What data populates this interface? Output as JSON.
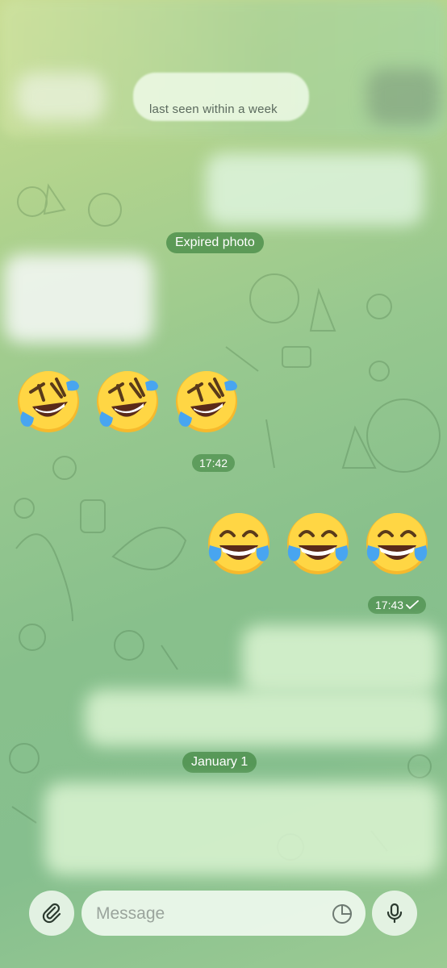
{
  "header": {
    "status": "last seen within a week"
  },
  "chat": {
    "expired_photo_label": "Expired photo",
    "incoming_emoji": [
      "🤣",
      "🤣",
      "🤣"
    ],
    "incoming_time": "17:42",
    "outgoing_emoji": [
      "😂",
      "😂",
      "😂"
    ],
    "outgoing_time": "17:43",
    "outgoing_status_icon": "single-check-icon",
    "date_separator": "January 1"
  },
  "input": {
    "placeholder": "Message",
    "attach_icon": "paperclip-icon",
    "sticker_icon": "sticker-icon",
    "mic_icon": "microphone-icon"
  },
  "colors": {
    "chip_bg": "#4f9a4f",
    "bar_bg": "#e9f5e9",
    "icon": "#2b3a2f"
  }
}
